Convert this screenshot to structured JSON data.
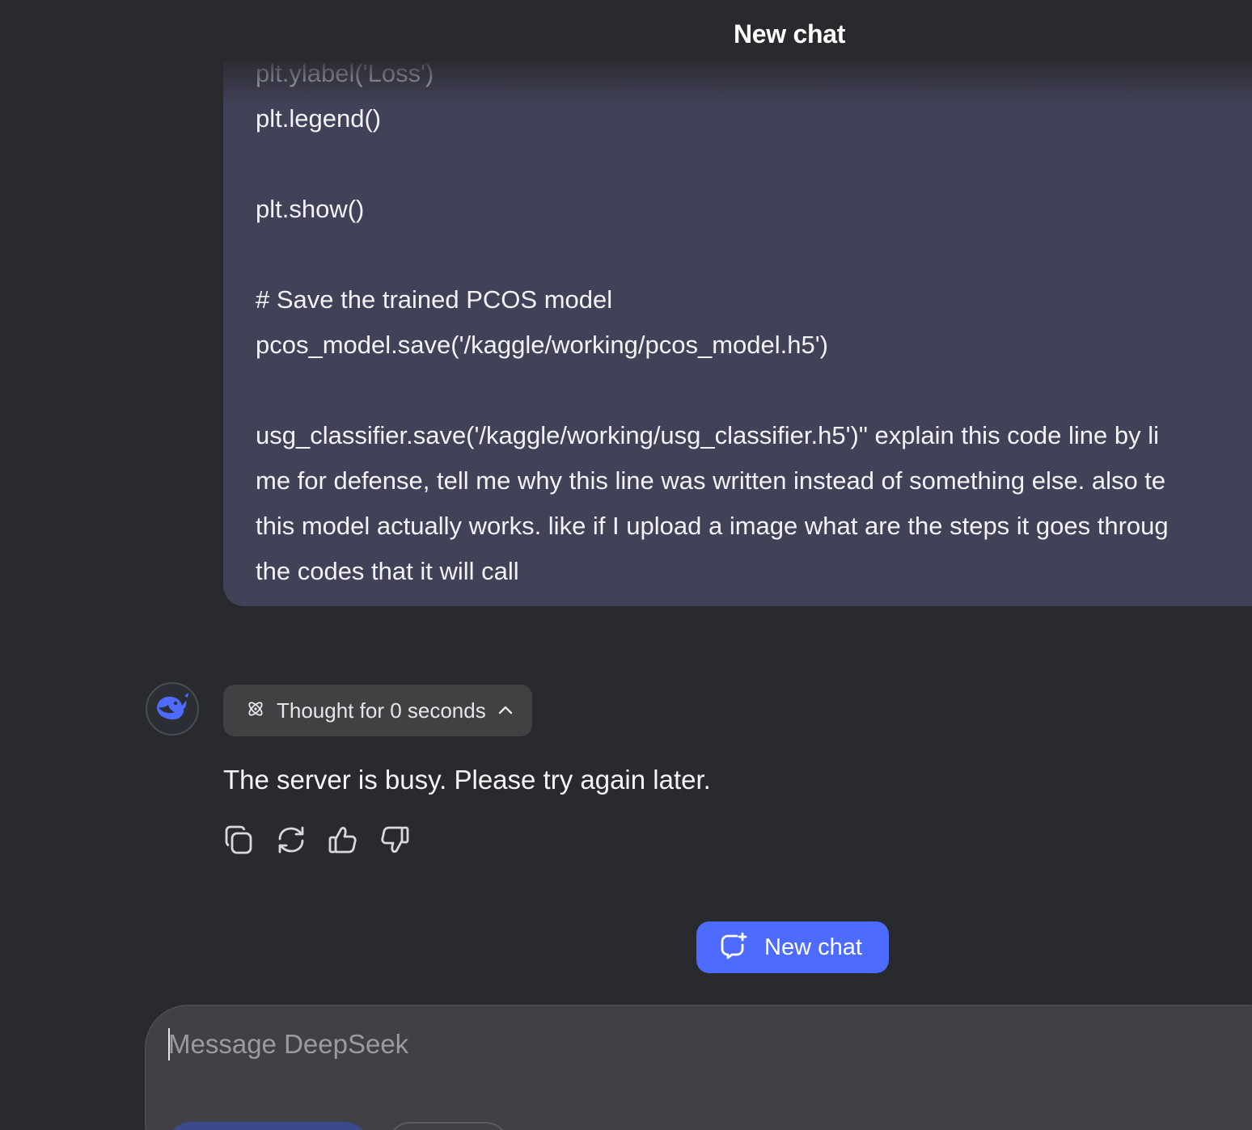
{
  "header": {
    "title": "New chat"
  },
  "user_message": {
    "lines": [
      "plt.ylabel('Loss')",
      "plt.legend()",
      "plt.show()",
      "# Save the trained PCOS model",
      "pcos_model.save('/kaggle/working/pcos_model.h5')",
      "usg_classifier.save('/kaggle/working/usg_classifier.h5')\" explain this code line by li",
      "me for defense, tell me why this line was written instead of something else. also te",
      "this model actually works. like if I upload a image what are the steps it goes throug",
      "the codes that it will call"
    ]
  },
  "assistant": {
    "avatar_icon": "deepseek-whale-icon",
    "thought_icon": "atom-icon",
    "thought_label": "Thought for 0 seconds",
    "thought_chevron_icon": "chevron-up-icon",
    "response_text": "The server is busy. Please try again later.",
    "actions": [
      {
        "name": "copy-button",
        "icon": "copy-icon"
      },
      {
        "name": "regenerate-button",
        "icon": "refresh-icon"
      },
      {
        "name": "like-button",
        "icon": "thumbs-up-icon"
      },
      {
        "name": "dislike-button",
        "icon": "thumbs-down-icon"
      }
    ]
  },
  "new_chat_button": {
    "label": "New chat",
    "icon": "new-chat-icon"
  },
  "composer": {
    "placeholder": "Message DeepSeek",
    "value": ""
  },
  "colors": {
    "background": "#292a2d",
    "user_bubble": "#414158",
    "accent": "#4d6bfe",
    "thought_button": "#414144",
    "composer": "#404045"
  }
}
